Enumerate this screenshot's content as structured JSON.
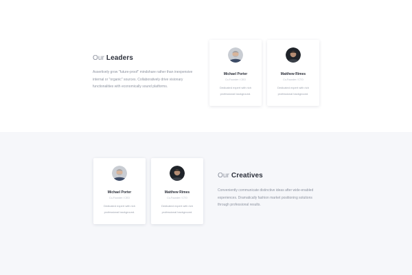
{
  "leaders": {
    "heading_prefix": "Our",
    "heading_strong": "Leaders",
    "description_lines": [
      "Assertively grow \"future-proof\" mindshare rather than inexpensive",
      "internal or \"organic\" sources. Collaboratively drive visionary",
      "functionalities with economically sound platforms."
    ],
    "members": [
      {
        "name": "Michael Porter",
        "role": "Co-Founder / CEO",
        "bio_lines": [
          "Dedicated expert with rich",
          "professional background."
        ],
        "avatar": "avatar-michael"
      },
      {
        "name": "Matthew Rimes",
        "role": "Co-Founder / CTO",
        "bio_lines": [
          "Dedicated expert with rich",
          "professional background."
        ],
        "avatar": "avatar-matthew"
      }
    ]
  },
  "creatives": {
    "heading_prefix": "Our",
    "heading_strong": "Creatives",
    "description_lines": [
      "Conveniently communicate distinctive ideas after wide-enabled",
      "experiences. Dramatically fashion market positioning solutions",
      "through professional results."
    ],
    "members": [
      {
        "name": "Michael Porter",
        "role": "Co-Founder / CEO",
        "bio_lines": [
          "Dedicated expert with rich",
          "professional background."
        ],
        "avatar": "avatar-michael"
      },
      {
        "name": "Matthew Rimes",
        "role": "Co-Founder / CTO",
        "bio_lines": [
          "Dedicated expert with rich",
          "professional background."
        ],
        "avatar": "avatar-matthew"
      }
    ]
  },
  "colors": {
    "page_background": "#ffffff",
    "alt_section_background": "#f6f7fa",
    "heading_text": "#2b2f3a",
    "muted_text": "#8d93a0"
  }
}
